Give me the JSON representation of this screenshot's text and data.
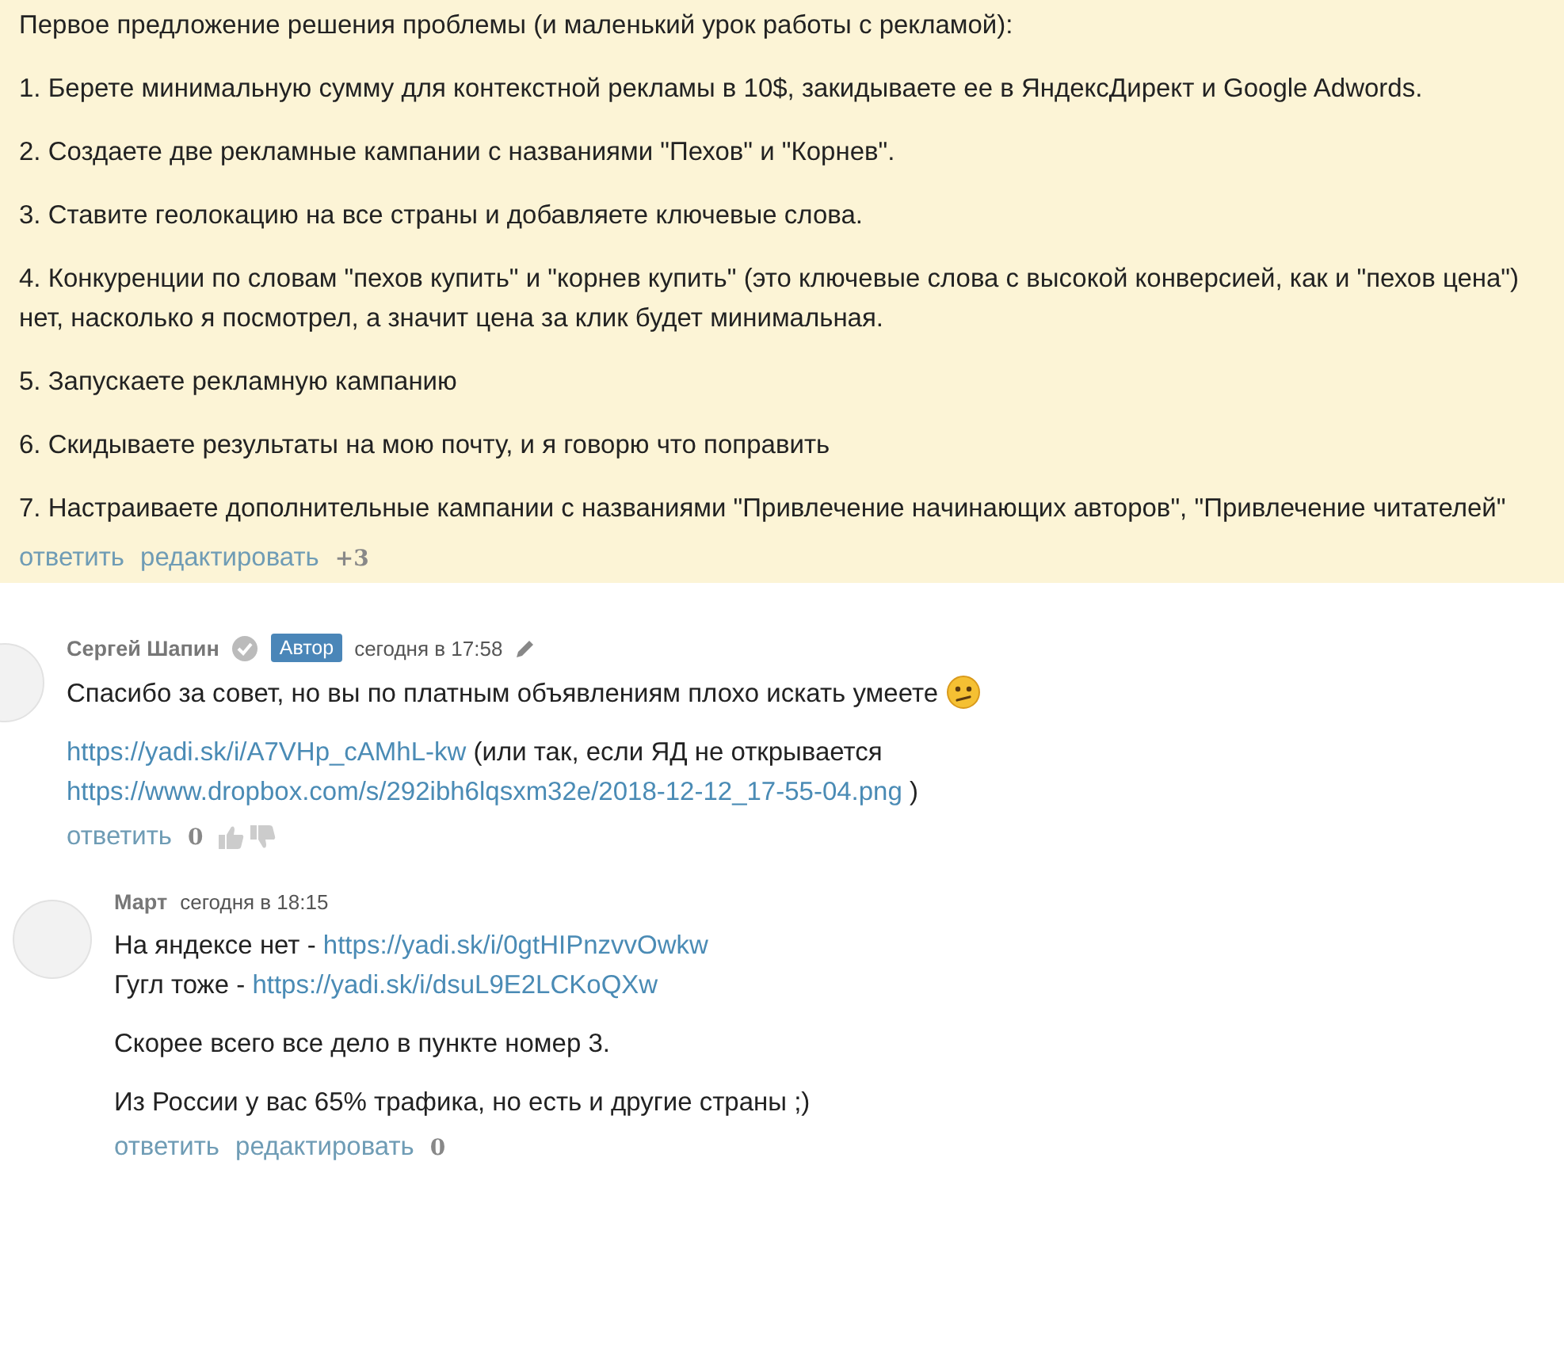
{
  "post": {
    "paragraphs": [
      {
        "parts": [
          {
            "kind": "text",
            "text": "Первое предложение решения проблемы (и маленький урок работы с рекламой):"
          }
        ]
      },
      {
        "parts": [
          {
            "kind": "text",
            "text": "1. Берете минимальную сумму для контекстной рекламы в 10$, закидываете ее в ЯндексДирект и Google Adwords."
          }
        ]
      },
      {
        "parts": [
          {
            "kind": "text",
            "text": "2. Создаете две рекламные кампании с названиями \"Пехов\" и \"Корнев\"."
          }
        ]
      },
      {
        "parts": [
          {
            "kind": "text",
            "text": "3. Ставите геолокацию на все страны и добавляете ключевые слова."
          }
        ]
      },
      {
        "parts": [
          {
            "kind": "text",
            "text": "4. Конкуренции по словам \"пехов купить\" и \"корнев купить\" (это ключевые слова с высокой конверсией, как и \"пехов цена\") нет, насколько я посмотрел, а значит цена за клик будет минимальная."
          }
        ]
      },
      {
        "parts": [
          {
            "kind": "text",
            "text": "5. Запускаете рекламную кампанию"
          }
        ]
      },
      {
        "parts": [
          {
            "kind": "text",
            "text": "6. Скидываете результаты на мою почту, и я говорю что поправить"
          }
        ]
      },
      {
        "parts": [
          {
            "kind": "text",
            "text": "7. Настраиваете дополнительные кампании с названиями \"Привлечение начинающих авторов\", \"Привлечение читателей\""
          }
        ]
      }
    ],
    "actions": [
      "ответить",
      "редактировать"
    ],
    "score": "+3",
    "votes": false
  },
  "comments": [
    {
      "author": "Сергей Шапин",
      "verified": true,
      "badge": "Автор",
      "time": "сегодня в 17:58",
      "edited": true,
      "indent": false,
      "paragraphs": [
        {
          "parts": [
            {
              "kind": "text",
              "text": "Спасибо за совет, но вы по платным объявлениям плохо искать умеете"
            },
            {
              "kind": "emoji"
            }
          ]
        },
        {
          "parts": [
            {
              "kind": "link",
              "text": "https://yadi.sk/i/A7VHp_cAMhL-kw"
            },
            {
              "kind": "text",
              "text": "(или так, если ЯД не открывается"
            },
            {
              "kind": "link",
              "text": "https://www.dropbox.com/s/292ibh6lqsxm32e/2018-12-12_17-55-04.png"
            },
            {
              "kind": "text",
              "text": ")"
            }
          ]
        }
      ],
      "actions": [
        "ответить"
      ],
      "score": "0",
      "votes": true
    },
    {
      "author": "Март",
      "verified": false,
      "time": "сегодня в 18:15",
      "edited": false,
      "indent": true,
      "paragraphs": [
        {
          "parts": [
            {
              "kind": "text",
              "text": "На яндексе нет -"
            },
            {
              "kind": "link",
              "text": "https://yadi.sk/i/0gtHIPnzvvOwkw"
            },
            {
              "kind": "break"
            },
            {
              "kind": "text",
              "text": "Гугл тоже -"
            },
            {
              "kind": "link",
              "text": "https://yadi.sk/i/dsuL9E2LCKoQXw"
            }
          ]
        },
        {
          "parts": [
            {
              "kind": "text",
              "text": "Скорее всего все дело в пункте номер 3."
            }
          ]
        },
        {
          "parts": [
            {
              "kind": "text",
              "text": "Из России у вас 65% трафика, но есть и другие страны ;)"
            }
          ]
        }
      ],
      "actions": [
        "ответить",
        "редактировать"
      ],
      "score": "0",
      "votes": false
    }
  ]
}
